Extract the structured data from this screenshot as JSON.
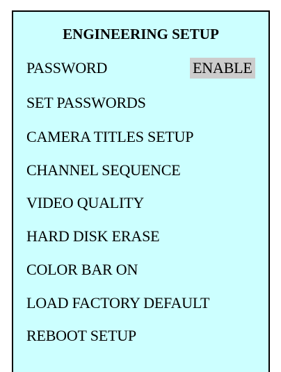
{
  "menu": {
    "title": "ENGINEERING SETUP",
    "password": {
      "label": "PASSWORD",
      "value": "ENABLE"
    },
    "items": [
      {
        "label": "SET PASSWORDS"
      },
      {
        "label": "CAMERA TITLES SETUP"
      },
      {
        "label": "CHANNEL SEQUENCE"
      },
      {
        "label": "VIDEO QUALITY"
      },
      {
        "label": "HARD DISK ERASE"
      },
      {
        "label": "COLOR BAR ON"
      },
      {
        "label": "LOAD FACTORY DEFAULT"
      },
      {
        "label": "REBOOT SETUP"
      }
    ]
  },
  "colors": {
    "panel_background": "#ccffff",
    "highlight_background": "#cccccc",
    "border": "#000000",
    "text": "#000000"
  }
}
